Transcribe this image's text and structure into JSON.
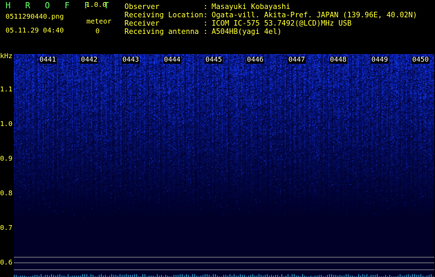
{
  "header": {
    "app_title": "H R O F F T",
    "app_version": "1.0.0",
    "file_name": "0511290440.png",
    "timestamp": "05.11.29 04:40",
    "meteor_label": "meteor",
    "meteor_count": "0",
    "info": [
      {
        "key": "Observer",
        "value": "Masayuki Kobayashi"
      },
      {
        "key": "Receiving Location",
        "value": "Ogata-vill. Akita-Pref. JAPAN (139.96E, 40.02N)"
      },
      {
        "key": "Receiver",
        "value": "ICOM IC-575 53.7492(@LCD)MHz USB"
      },
      {
        "key": "Receiving antenna",
        "value": "A504HB(yagi 4el)"
      }
    ],
    "separator": ":"
  },
  "spectrogram": {
    "y_unit": "kHz",
    "y_ticks": [
      "1.1",
      "1.0",
      "0.9",
      "0.8",
      "0.7",
      "0.6"
    ],
    "minute_labels": [
      "0441",
      "0442",
      "0443",
      "0444",
      "0445",
      "0446",
      "0447",
      "0448",
      "0449",
      "0450"
    ],
    "colors": {
      "signal": "#2a3cff",
      "background": "#000010",
      "text_yellow": "#ffff33",
      "text_green": "#66ff66"
    }
  }
}
